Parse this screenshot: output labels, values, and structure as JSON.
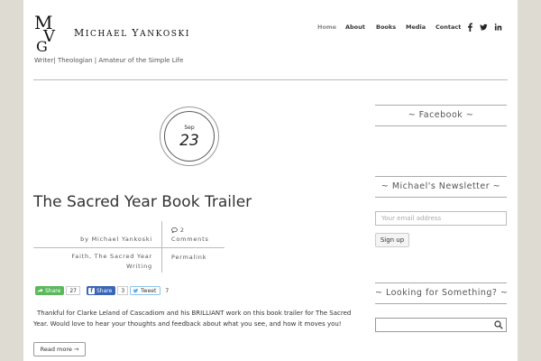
{
  "header": {
    "site_name_first_initial": "M",
    "site_name_first_rest": "ICHAEL",
    "site_name_last_initial": "Y",
    "site_name_last_rest": "ANKOSKI",
    "tagline": "Writer| Theologian | Amateur of the Simple Life",
    "logo": "MVG monogram logo"
  },
  "nav": {
    "items": [
      {
        "label": "Home",
        "active": true
      },
      {
        "label": "About"
      },
      {
        "label": "Books"
      },
      {
        "label": "Media"
      },
      {
        "label": "Contact"
      }
    ],
    "social": [
      "facebook-icon",
      "twitter-icon",
      "linkedin-icon"
    ]
  },
  "post": {
    "date_month": "Sep",
    "date_day": "23",
    "title": "The Sacred Year Book Trailer",
    "by_prefix": "by",
    "author": "Michael Yankoski",
    "comments_count": "2",
    "comments_label": "Comments",
    "categories_line1": "Faith, The Sacred Year",
    "categories_line2": "Writing",
    "permalink_label": "Permalink",
    "excerpt_line1": "Thankful for Clarke Leland of Cascadiom and his BRILLIANT work on this book trailer for The Sacred",
    "excerpt_line2": "Year. Would love to hear your thoughts and feedback about what you see, and how it moves you!",
    "read_more": "Read more →"
  },
  "share": {
    "share_label": "Share",
    "share_count": "27",
    "fb_label": "Share",
    "fb_count": "3",
    "tweet_label": "Tweet",
    "tweet_count": "7",
    "share_color": "#5cb85c",
    "fb_color": "#3b65b5",
    "tweet_border": "#8cc3e8"
  },
  "sidebar": {
    "facebook_title": "~ Facebook ~",
    "newsletter_title": "~ Michael's Newsletter ~",
    "email_placeholder": "Your email address",
    "signup_label": "Sign up",
    "search_title": "~ Looking for Something? ~",
    "search_value": ""
  },
  "colors": {
    "background": "#dddbd2",
    "page": "#ffffff",
    "active_nav": "#888888"
  }
}
